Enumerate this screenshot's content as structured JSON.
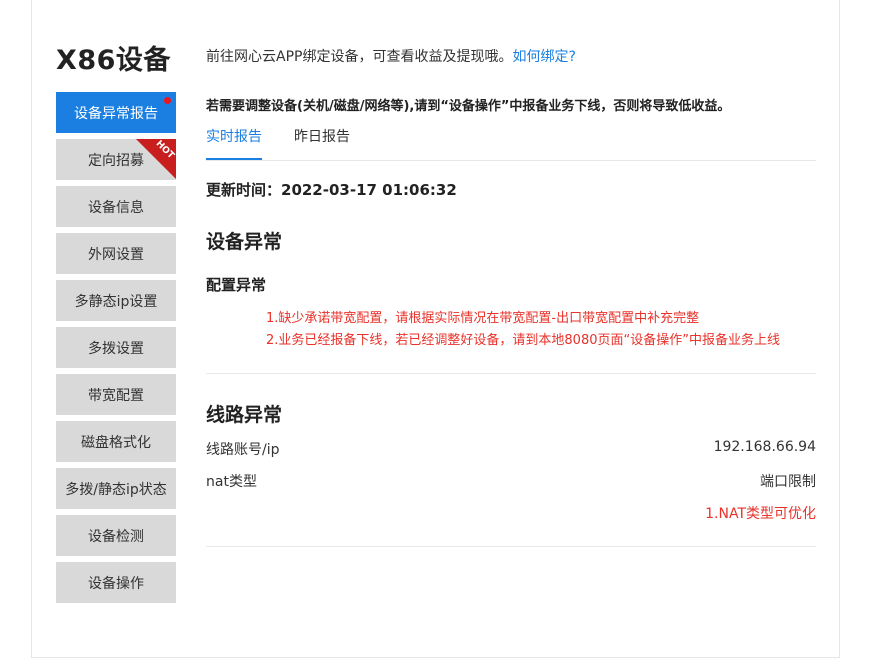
{
  "page_title": "X86设备",
  "sidebar": {
    "items": [
      {
        "label": "设备异常报告"
      },
      {
        "label": "定向招募",
        "badge": "HOT"
      },
      {
        "label": "设备信息"
      },
      {
        "label": "外网设置"
      },
      {
        "label": "多静态ip设置"
      },
      {
        "label": "多拨设置"
      },
      {
        "label": "带宽配置"
      },
      {
        "label": "磁盘格式化"
      },
      {
        "label": "多拨/静态ip状态"
      },
      {
        "label": "设备检测"
      },
      {
        "label": "设备操作"
      }
    ]
  },
  "intro": {
    "text": "前往网心云APP绑定设备，可查看收益及提现哦。",
    "link": "如何绑定?"
  },
  "warning": "若需要调整设备(关机/磁盘/网络等),请到“设备操作”中报备业务下线，否则将导致低收益。",
  "tabs": [
    {
      "label": "实时报告"
    },
    {
      "label": "昨日报告"
    }
  ],
  "update_time": "更新时间：2022-03-17 01:06:32",
  "device_abnormal": {
    "title": "设备异常",
    "config_title": "配置异常",
    "errors": [
      "1.缺少承诺带宽配置，请根据实际情况在带宽配置-出口带宽配置中补充完整",
      "2.业务已经报备下线，若已经调整好设备，请到本地8080页面“设备操作”中报备业务上线"
    ]
  },
  "line_abnormal": {
    "title": "线路异常",
    "rows": [
      {
        "label": "线路账号/ip",
        "value": "192.168.66.94"
      },
      {
        "label": "nat类型",
        "value": "端口限制"
      }
    ],
    "errors": [
      "1.NAT类型可优化"
    ]
  },
  "colors": {
    "accent": "#1a7fe0",
    "error": "#e8322a",
    "sidebar_bg": "#d9d9d9"
  }
}
